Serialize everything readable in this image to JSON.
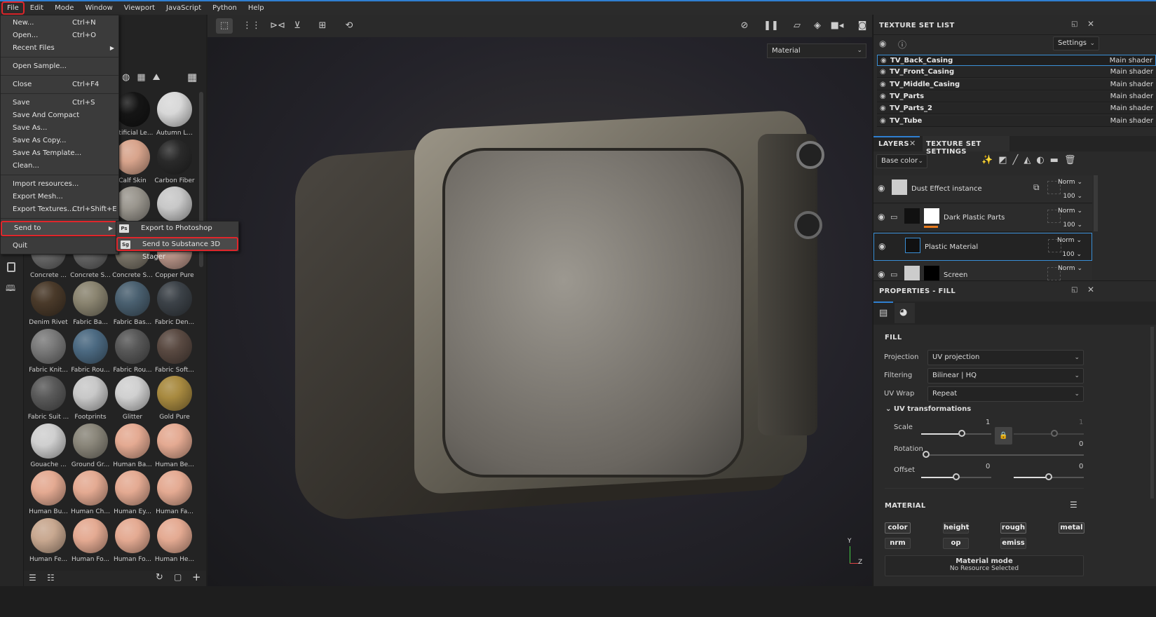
{
  "menubar": [
    "File",
    "Edit",
    "Mode",
    "Window",
    "Viewport",
    "JavaScript",
    "Python",
    "Help"
  ],
  "file_menu": [
    {
      "label": "New...",
      "shortcut": "Ctrl+N"
    },
    {
      "label": "Open...",
      "shortcut": "Ctrl+O"
    },
    {
      "label": "Recent Files",
      "shortcut": "",
      "submenu": true
    },
    {
      "sep": true
    },
    {
      "label": "Open Sample...",
      "shortcut": ""
    },
    {
      "sep": true
    },
    {
      "label": "Close",
      "shortcut": "Ctrl+F4"
    },
    {
      "sep": true
    },
    {
      "label": "Save",
      "shortcut": "Ctrl+S"
    },
    {
      "label": "Save And Compact",
      "shortcut": ""
    },
    {
      "label": "Save As...",
      "shortcut": ""
    },
    {
      "label": "Save As Copy...",
      "shortcut": ""
    },
    {
      "label": "Save As Template...",
      "shortcut": ""
    },
    {
      "label": "Clean...",
      "shortcut": ""
    },
    {
      "sep": true
    },
    {
      "label": "Import resources...",
      "shortcut": ""
    },
    {
      "label": "Export Mesh...",
      "shortcut": ""
    },
    {
      "label": "Export Textures...",
      "shortcut": "Ctrl+Shift+E"
    },
    {
      "sep": true
    },
    {
      "label": "Send to",
      "shortcut": "",
      "submenu": true,
      "highlight": true
    },
    {
      "sep": true
    },
    {
      "label": "Quit",
      "shortcut": ""
    }
  ],
  "send_to_menu": [
    {
      "badge": "Ps",
      "label": "Export to Photoshop"
    },
    {
      "badge": "Sg",
      "label": "Send to Substance 3D Stager",
      "highlight": true
    }
  ],
  "shelf": {
    "materials": [
      {
        "label": "",
        "color": "#777"
      },
      {
        "label": "",
        "color": "#888"
      },
      {
        "label": "Artificial Le...",
        "color": "#151515"
      },
      {
        "label": "Autumn L...",
        "color": "#d8d8d8"
      },
      {
        "label": "",
        "color": "#777"
      },
      {
        "label": "",
        "color": "#888"
      },
      {
        "label": "Calf Skin",
        "color": "#d8a48c"
      },
      {
        "label": "Carbon Fiber",
        "color": "#2a2a2a"
      },
      {
        "label": "",
        "color": "#777"
      },
      {
        "label": "",
        "color": "#888"
      },
      {
        "label": "",
        "color": "#9a968e"
      },
      {
        "label": "",
        "color": "#c8c8c8"
      },
      {
        "label": "Concrete ...",
        "color": "#6a6a6a"
      },
      {
        "label": "Concrete S...",
        "color": "#666"
      },
      {
        "label": "Concrete S...",
        "color": "#7a7468"
      },
      {
        "label": "Copper Pure",
        "color": "#b89488"
      },
      {
        "label": "Denim Rivet",
        "color": "#4a3a2a"
      },
      {
        "label": "Fabric Ba...",
        "color": "#8a8470"
      },
      {
        "label": "Fabric Bas...",
        "color": "#4a6070"
      },
      {
        "label": "Fabric Den...",
        "color": "#3c4248"
      },
      {
        "label": "Fabric Knit...",
        "color": "#7a7a7a"
      },
      {
        "label": "Fabric Rou...",
        "color": "#4c6a82"
      },
      {
        "label": "Fabric Rou...",
        "color": "#585858"
      },
      {
        "label": "Fabric Soft...",
        "color": "#5a4a42"
      },
      {
        "label": "Fabric Suit ...",
        "color": "#5a5a5a"
      },
      {
        "label": "Footprints",
        "color": "#c8c8c8"
      },
      {
        "label": "Glitter",
        "color": "#d0d0d0"
      },
      {
        "label": "Gold Pure",
        "color": "#a88a40"
      },
      {
        "label": "Gouache ...",
        "color": "#cfcfcf"
      },
      {
        "label": "Ground Gr...",
        "color": "#8a867a"
      },
      {
        "label": "Human Ba...",
        "color": "#e4aa92"
      },
      {
        "label": "Human Be...",
        "color": "#e4aa92"
      },
      {
        "label": "Human Bu...",
        "color": "#e4aa92"
      },
      {
        "label": "Human Ch...",
        "color": "#e4aa92"
      },
      {
        "label": "Human Ey...",
        "color": "#e4aa92"
      },
      {
        "label": "Human Fa...",
        "color": "#e4aa92"
      },
      {
        "label": "Human Fe...",
        "color": "#c8a890"
      },
      {
        "label": "Human Fo...",
        "color": "#e4aa92"
      },
      {
        "label": "Human Fo...",
        "color": "#e4aa92"
      },
      {
        "label": "Human He...",
        "color": "#e4aa92"
      }
    ]
  },
  "viewport": {
    "material_dropdown": "Material",
    "axis": {
      "y": "Y",
      "z": "Z"
    }
  },
  "texture_set_list": {
    "title": "TEXTURE SET LIST",
    "settings": "Settings",
    "rows": [
      {
        "name": "TV_Back_Casing",
        "shader": "Main shader",
        "selected": true
      },
      {
        "name": "TV_Front_Casing",
        "shader": "Main shader"
      },
      {
        "name": "TV_Middle_Casing",
        "shader": "Main shader"
      },
      {
        "name": "TV_Parts",
        "shader": "Main shader"
      },
      {
        "name": "TV_Parts_2",
        "shader": "Main shader"
      },
      {
        "name": "TV_Tube",
        "shader": "Main shader"
      }
    ]
  },
  "layers": {
    "tab_layers": "LAYERS",
    "tab_tss": "TEXTURE SET SETTINGS",
    "channel": "Base color",
    "items": [
      {
        "name": "Dust Effect instance",
        "blend": "Norm",
        "opacity": "100"
      },
      {
        "name": "Dark Plastic Parts",
        "blend": "Norm",
        "opacity": "100"
      },
      {
        "name": "Plastic Material",
        "blend": "Norm",
        "opacity": "100",
        "selected": true
      },
      {
        "name": "Screen",
        "blend": "Norm",
        "opacity": ""
      }
    ]
  },
  "properties": {
    "title": "PROPERTIES - FILL",
    "fill": "FILL",
    "projection_label": "Projection",
    "projection": "UV projection",
    "filtering_label": "Filtering",
    "filtering": "Bilinear | HQ",
    "uvwrap_label": "UV Wrap",
    "uvwrap": "Repeat",
    "uvt": "UV transformations",
    "scale_label": "Scale",
    "scale_u": "1",
    "scale_v": "1",
    "rotation_label": "Rotation",
    "rotation": "0",
    "offset_label": "Offset",
    "offset_u": "0",
    "offset_v": "0",
    "material": "MATERIAL",
    "channels": [
      "color",
      "height",
      "rough",
      "metal",
      "nrm",
      "op",
      "emiss"
    ],
    "material_mode": "Material mode",
    "no_resource": "No Resource Selected"
  },
  "colors": {
    "accent": "#2f7fd1",
    "highlight": "#e0262b",
    "orange": "#e87b1e"
  }
}
